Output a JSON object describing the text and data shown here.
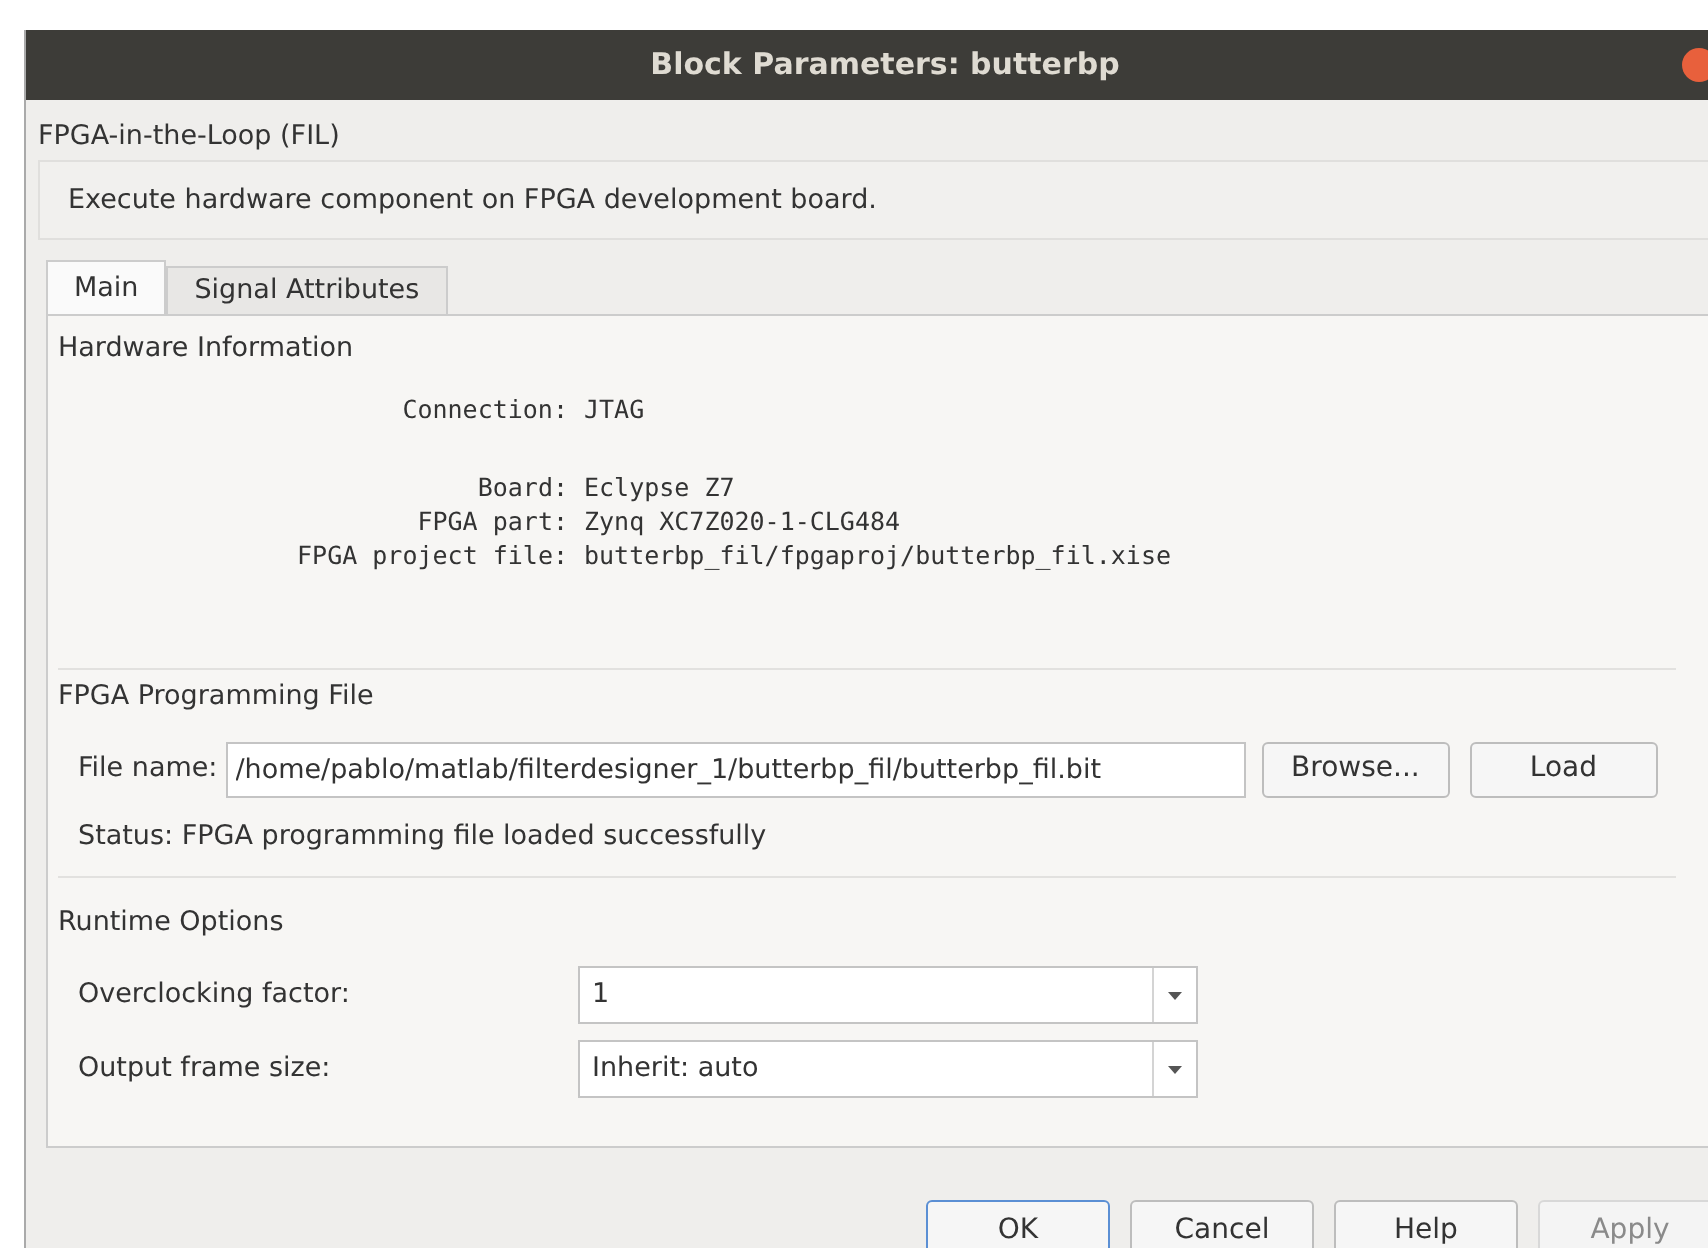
{
  "window": {
    "title": "Block Parameters: butterbp"
  },
  "block_type": "FPGA-in-the-Loop (FIL)",
  "description": "Execute hardware component on FPGA development board.",
  "tabs": [
    {
      "label": "Main",
      "selected": true
    },
    {
      "label": "Signal Attributes",
      "selected": false
    }
  ],
  "hardware_information": {
    "title": "Hardware Information",
    "groups": [
      [
        {
          "label": "Connection:",
          "value": "JTAG"
        }
      ],
      [
        {
          "label": "Board:",
          "value": "Eclypse Z7"
        },
        {
          "label": "FPGA part:",
          "value": "Zynq XC7Z020-1-CLG484"
        },
        {
          "label": "FPGA project file:",
          "value": "butterbp_fil/fpgaproj/butterbp_fil.xise"
        }
      ]
    ]
  },
  "programming_file": {
    "title": "FPGA Programming File",
    "label": "File name:",
    "value": "/home/pablo/matlab/filterdesigner_1/butterbp_fil/butterbp_fil.bit",
    "buttons": [
      {
        "label": "Browse...",
        "disabled": false
      },
      {
        "label": "Load",
        "disabled": false
      }
    ],
    "status": "Status: FPGA programming file loaded successfully"
  },
  "runtime_options": {
    "title": "Runtime Options",
    "fields": [
      {
        "label": "Overclocking factor:",
        "value": "1"
      },
      {
        "label": "Output frame size:",
        "value": "Inherit: auto"
      }
    ]
  },
  "buttons": [
    {
      "label": "OK",
      "disabled": false,
      "default": true
    },
    {
      "label": "Cancel",
      "disabled": false,
      "default": false
    },
    {
      "label": "Help",
      "disabled": false,
      "default": false
    },
    {
      "label": "Apply",
      "disabled": true,
      "default": false
    }
  ]
}
